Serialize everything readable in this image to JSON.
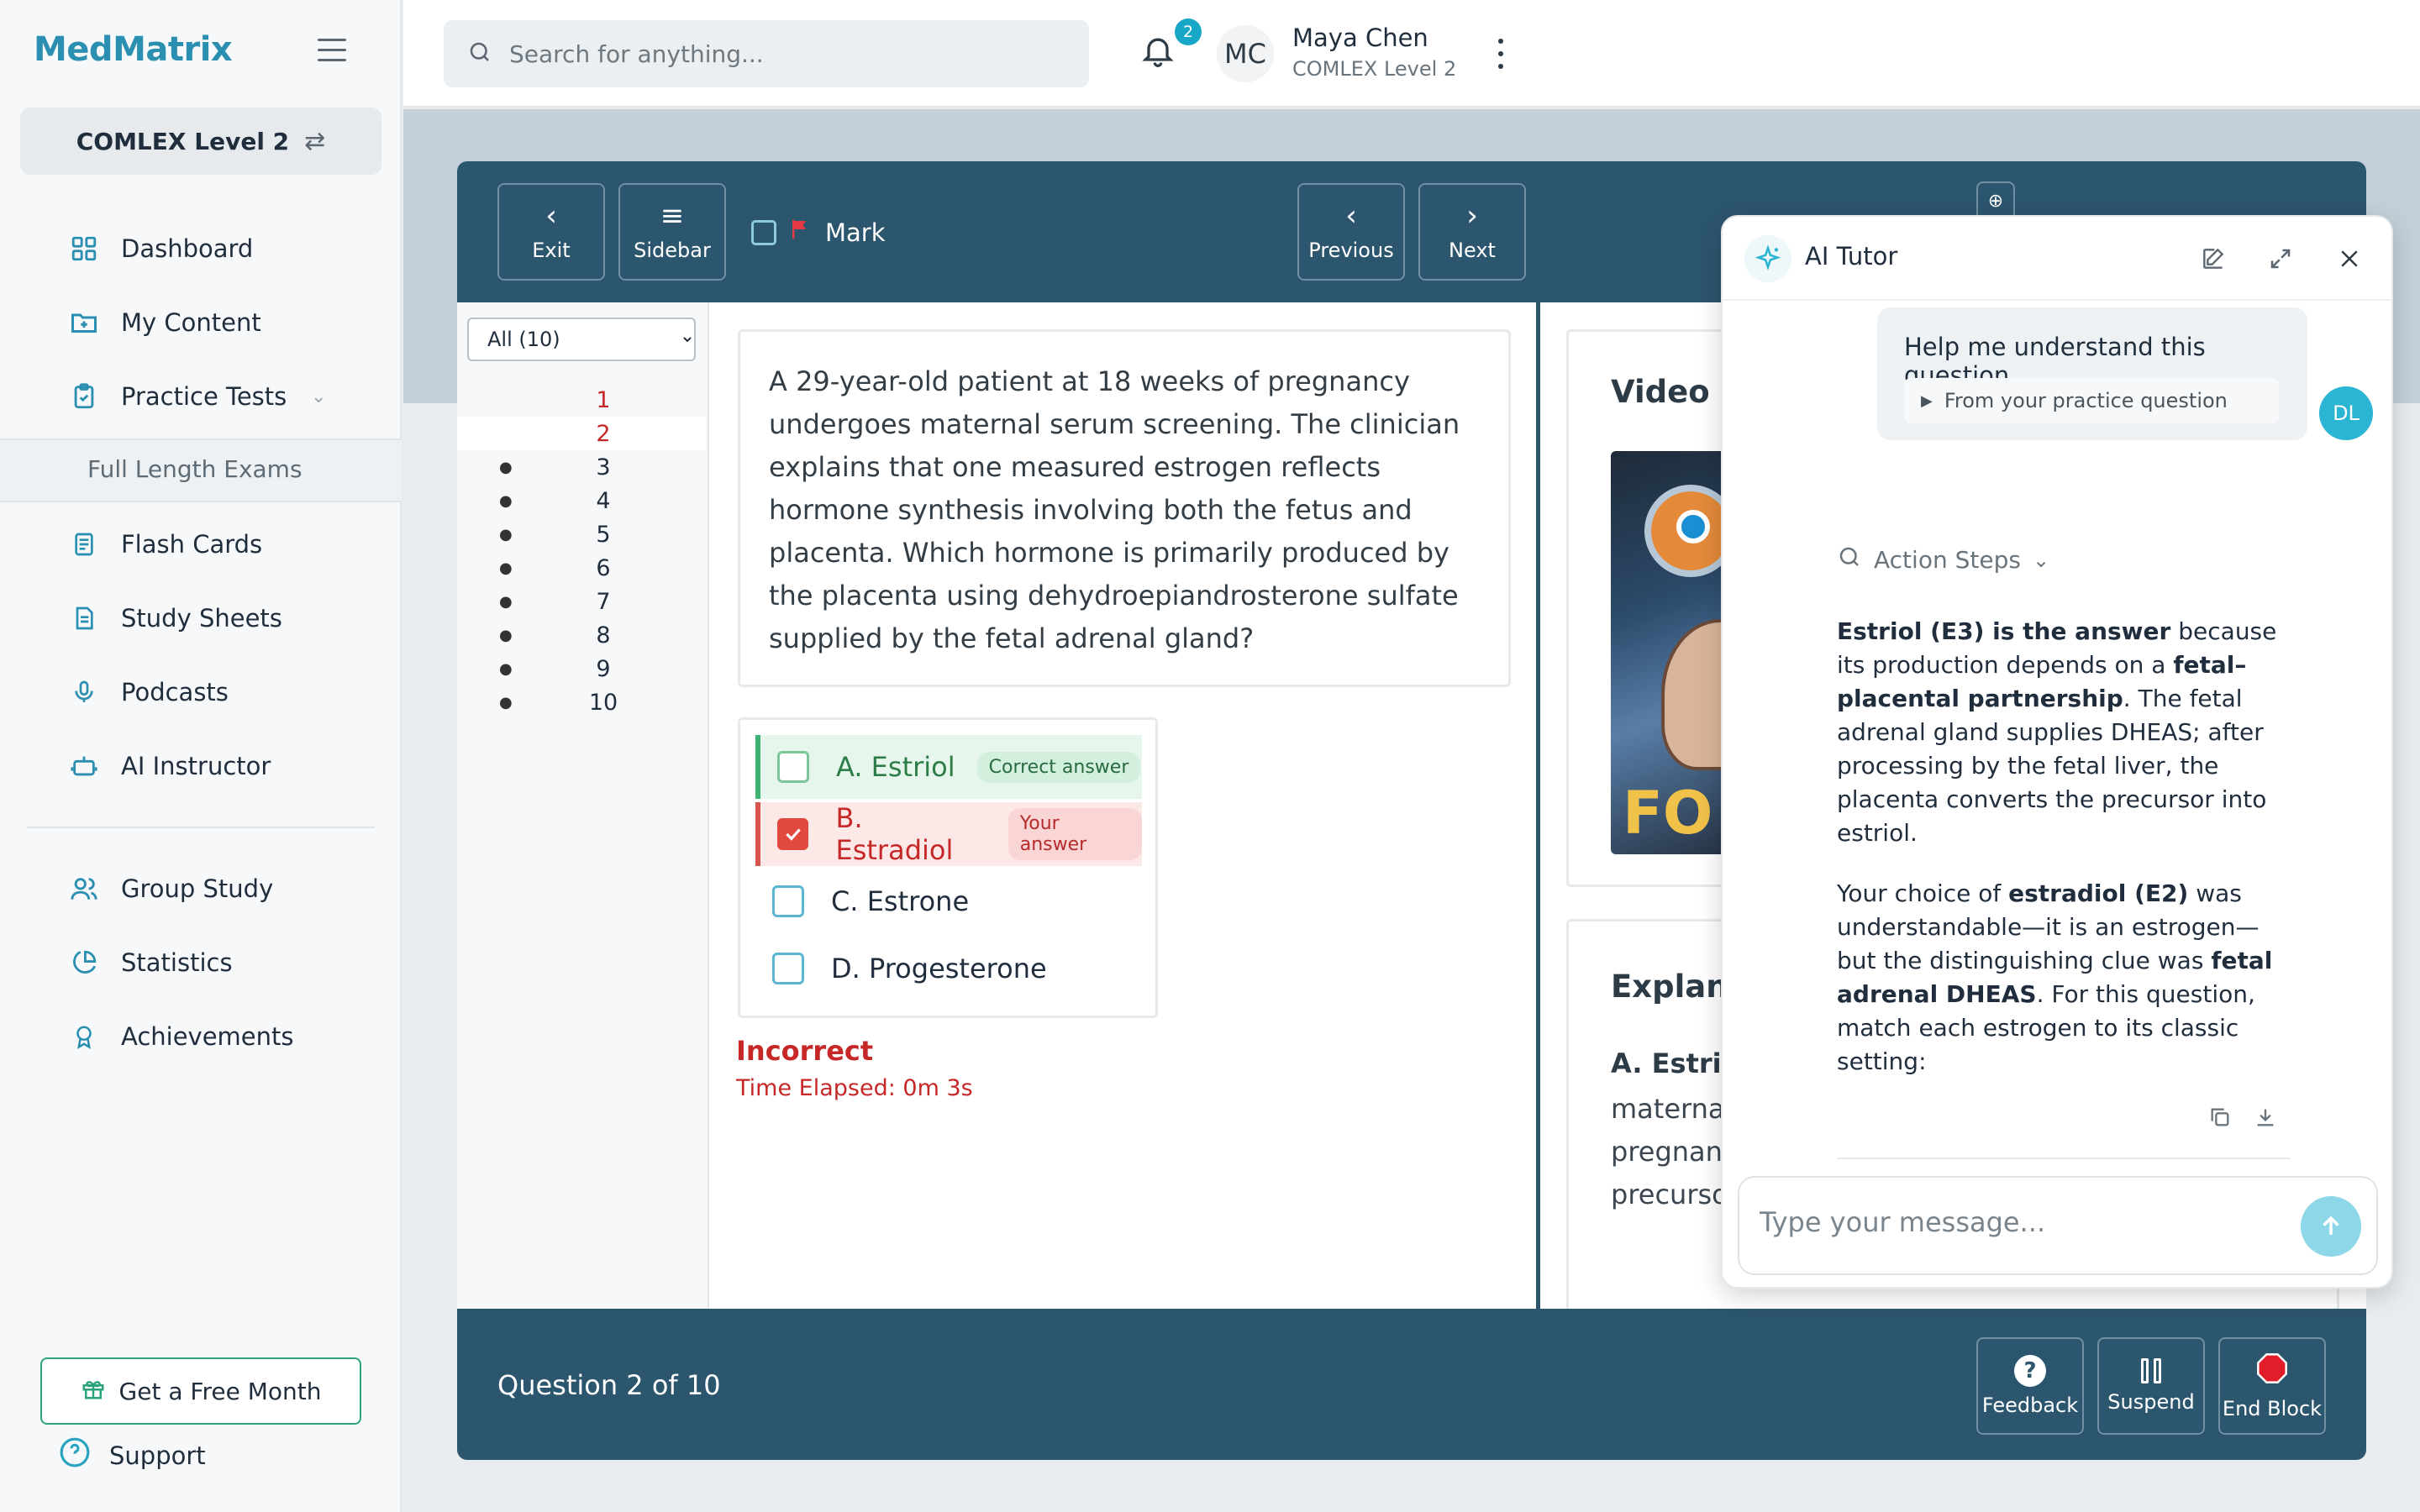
{
  "brand": {
    "logo_text": "MedMatrix",
    "accent_color": "#2a8fb0"
  },
  "sidebar": {
    "exam_selector": "COMLEX Level 2",
    "items": [
      {
        "label": "Dashboard",
        "icon": "grid-icon"
      },
      {
        "label": "My Content",
        "icon": "folder-plus-icon"
      },
      {
        "label": "Practice Tests",
        "icon": "clipboard-icon",
        "expanded": true
      },
      {
        "label": "Flash Cards",
        "icon": "document-icon"
      },
      {
        "label": "Study Sheets",
        "icon": "sheet-icon"
      },
      {
        "label": "Podcasts",
        "icon": "microphone-icon"
      },
      {
        "label": "AI Instructor",
        "icon": "robot-icon"
      },
      {
        "label": "Group Study",
        "icon": "users-icon"
      },
      {
        "label": "Statistics",
        "icon": "pie-chart-icon"
      },
      {
        "label": "Achievements",
        "icon": "award-icon"
      }
    ],
    "subitem": "Full Length Exams",
    "free_month": "Get a Free Month",
    "support": "Support"
  },
  "topbar": {
    "search_placeholder": "Search for anything...",
    "notifications_count": "2",
    "user_initials": "MC",
    "user_name": "Maya Chen",
    "user_level": "COMLEX Level 2"
  },
  "toolbar": {
    "exit": "Exit",
    "sidebar": "Sidebar",
    "mark": "Mark",
    "previous": "Previous",
    "next": "Next"
  },
  "question_list": {
    "filter": "All (10)",
    "numbers": [
      "1",
      "2",
      "3",
      "4",
      "5",
      "6",
      "7",
      "8",
      "9",
      "10"
    ],
    "current": 2
  },
  "question": {
    "stem": "A 29-year-old patient at 18 weeks of pregnancy undergoes maternal serum screening. The clinician explains that one measured estrogen reflects hormone synthesis involving both the fetus and placenta. Which hormone is primarily produced by the placenta using dehydroepiandrosterone sulfate supplied by the fetal adrenal gland?",
    "choices": [
      {
        "label": "A. Estriol",
        "tag": "Correct answer",
        "state": "correct"
      },
      {
        "label": "B. Estradiol",
        "tag": "Your answer",
        "state": "wrong"
      },
      {
        "label": "C. Estrone",
        "tag": "",
        "state": "none"
      },
      {
        "label": "D. Progesterone",
        "tag": "",
        "state": "none"
      }
    ],
    "result": "Incorrect",
    "elapsed": "Time Elapsed: 0m 3s"
  },
  "right_panel": {
    "video_title": "Video",
    "video_thumb_text": "FO",
    "explanation_title": "Explanation",
    "explanation_sub": "A. Estriol",
    "explanation_text": "maternal serum... adrenal gland... Estriol is ... pregnancy... adrenal gland supplying DHEAS as a precursor and"
  },
  "footer": {
    "question_count": "Question 2 of 10",
    "feedback": "Feedback",
    "suspend": "Suspend",
    "end_block": "End Block"
  },
  "tutor": {
    "title": "AI Tutor",
    "user_message": "Help me understand this question",
    "user_source": "From your practice question",
    "user_avatar": "DL",
    "action_steps": "Action Steps",
    "input_placeholder": "Type your message..."
  },
  "colors": {
    "panel": "#2c566e",
    "correct": "#3cb371",
    "wrong": "#d9534f",
    "tutor_accent": "#2cb5d3"
  }
}
